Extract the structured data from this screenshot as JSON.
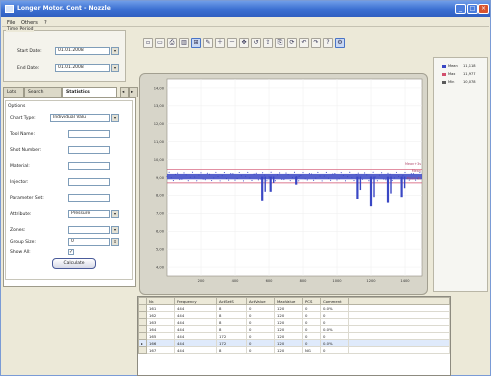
{
  "window": {
    "title": "Longer Motor. Cont - Nozzle"
  },
  "menu": [
    {
      "label": "File"
    },
    {
      "label": "Others"
    },
    {
      "label": "?"
    }
  ],
  "time_period": {
    "caption": "Time Period",
    "start_label": "Start Date:",
    "start_value": "01.01.2008",
    "end_label": "End Date:",
    "end_value": "01.01.2008"
  },
  "tabs": [
    {
      "label": "Lots"
    },
    {
      "label": "Search"
    },
    {
      "label": "Statistics"
    }
  ],
  "options": {
    "caption": "Options",
    "rows": [
      {
        "label": "Chart Type:",
        "value": "Individual Valu"
      },
      {
        "label": "Tool Name:",
        "value": ""
      },
      {
        "label": "Shot Number:",
        "value": ""
      },
      {
        "label": "Material:",
        "value": ""
      },
      {
        "label": "Injector:",
        "value": ""
      },
      {
        "label": "Parameter Set:",
        "value": ""
      },
      {
        "label": "Attribute:",
        "value": "Pressure"
      },
      {
        "label": "Zones:",
        "value": ""
      },
      {
        "label": "Group Size:",
        "value": "0"
      }
    ],
    "show_all_label": "Show All:",
    "show_all_checked": "✓",
    "calculate_label": "Calculate"
  },
  "toolbar": {
    "icons": [
      "new-icon",
      "open-icon",
      "print-icon",
      "chart-icon",
      "select-icon",
      "draw-icon",
      "zoom-in-icon",
      "zoom-out-icon",
      "pan-icon",
      "reset-icon",
      "export-icon",
      "copy-icon",
      "refresh-icon",
      "undo-icon",
      "redo-icon",
      "help-icon",
      "options-icon"
    ],
    "glyphs": [
      "▫",
      "▭",
      "⎙",
      "▥",
      "⊞",
      "✎",
      "＋",
      "－",
      "✥",
      "↺",
      "⇪",
      "⎘",
      "⟳",
      "↶",
      "↷",
      "?",
      "⚙"
    ]
  },
  "chart_data": {
    "type": "line",
    "title": "",
    "xlabel": "",
    "ylabel": "",
    "x_ticks": [
      "200",
      "400",
      "600",
      "800",
      "1000",
      "1200",
      "1400"
    ],
    "y_ticks": [
      "14,00",
      "13,00",
      "12,00",
      "11,00",
      "10,00",
      "9,00",
      "8,00",
      "7,00",
      "6,00",
      "5,00",
      "4,00"
    ],
    "xlim": [
      0,
      1500
    ],
    "ylim": [
      3.5,
      14.5
    ],
    "grid": true,
    "series": [
      {
        "name": "",
        "color": "#3a47c4",
        "segments": [
          {
            "x": [
              0,
              1500
            ],
            "y_mean": 9.05,
            "y_spread": 0.15
          }
        ]
      }
    ],
    "limit_lines": [
      {
        "value": 9.45,
        "color": "#d24f6d",
        "label": "Mean+3s"
      },
      {
        "value": 8.7,
        "color": "#d24f6d",
        "label": "Mean-3s"
      }
    ],
    "dips": [
      {
        "x": 560,
        "y_min": 7.7
      },
      {
        "x": 610,
        "y_min": 8.2
      },
      {
        "x": 760,
        "y_min": 8.6
      },
      {
        "x": 1120,
        "y_min": 7.8
      },
      {
        "x": 1200,
        "y_min": 7.4
      },
      {
        "x": 1300,
        "y_min": 7.6
      },
      {
        "x": 1380,
        "y_min": 7.9
      }
    ],
    "right_labels": [
      "Mean+3s",
      "Mean",
      "Mean-3s"
    ]
  },
  "legend": [
    {
      "name": "Mean",
      "value": "11,118",
      "color": "#3a47c4"
    },
    {
      "name": "Max",
      "value": "11,977",
      "color": "#d24f6d"
    },
    {
      "name": "Min",
      "value": "10,078",
      "color": "#5a5a5a"
    }
  ],
  "grid": {
    "columns": [
      "Nr.",
      "Frequency",
      "ActSetS",
      "ActValue",
      "MaxValue",
      "PCS",
      "Comment"
    ],
    "rows": [
      [
        "161",
        "444",
        "8",
        "0",
        "120",
        "0",
        "0.0%"
      ],
      [
        "162",
        "444",
        "8",
        "0",
        "120",
        "0",
        "0"
      ],
      [
        "163",
        "444",
        "8",
        "0",
        "120",
        "0",
        "0"
      ],
      [
        "164",
        "444",
        "8",
        "0",
        "120",
        "0",
        "0.0%"
      ],
      [
        "165",
        "444",
        "172",
        "0",
        "120",
        "0",
        "0"
      ],
      [
        "166",
        "444",
        "172",
        "0",
        "120",
        "0",
        "0.0%"
      ],
      [
        "167",
        "444",
        "8",
        "0",
        "120",
        "NG",
        "0"
      ]
    ],
    "selected_row": 5
  }
}
